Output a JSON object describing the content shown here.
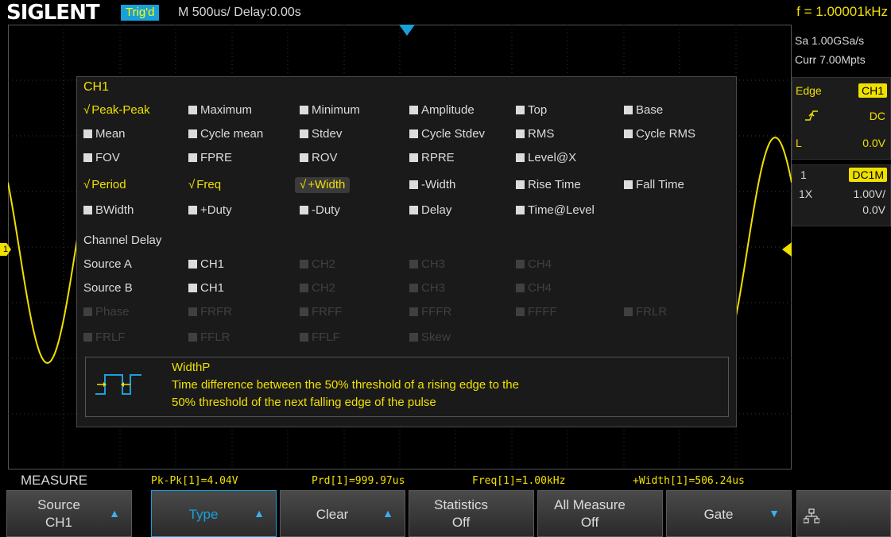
{
  "header": {
    "brand": "SIGLENT",
    "trigger_status": "Trig'd",
    "timebase": "M 500us/   Delay:0.00s",
    "frequency": "f = 1.00001kHz"
  },
  "right_panel": {
    "sample_rate": "Sa 1.00GSa/s",
    "memory": "Curr 7.00Mpts",
    "trigger_type": "Edge",
    "trigger_source": "CH1",
    "coupling": "DC",
    "level_label": "L",
    "level_value": "0.0V",
    "channel_number": "1",
    "channel_coupling": "DC1M",
    "probe": "1X",
    "volts_div": "1.00V/",
    "offset": "0.0V"
  },
  "dialog": {
    "title": "CH1",
    "rows": [
      [
        {
          "label": "Peak-Peak",
          "state": "on"
        },
        {
          "label": "Maximum",
          "state": "off"
        },
        {
          "label": "Minimum",
          "state": "off"
        },
        {
          "label": "Amplitude",
          "state": "off"
        },
        {
          "label": "Top",
          "state": "off"
        },
        {
          "label": "Base",
          "state": "off"
        }
      ],
      [
        {
          "label": "Mean",
          "state": "off"
        },
        {
          "label": "Cycle mean",
          "state": "off"
        },
        {
          "label": "Stdev",
          "state": "off"
        },
        {
          "label": "Cycle Stdev",
          "state": "off"
        },
        {
          "label": "RMS",
          "state": "off"
        },
        {
          "label": "Cycle RMS",
          "state": "off"
        }
      ],
      [
        {
          "label": "FOV",
          "state": "off"
        },
        {
          "label": "FPRE",
          "state": "off"
        },
        {
          "label": "ROV",
          "state": "off"
        },
        {
          "label": "RPRE",
          "state": "off"
        },
        {
          "label": "Level@X",
          "state": "off"
        }
      ],
      [
        {
          "label": "Period",
          "state": "on"
        },
        {
          "label": "Freq",
          "state": "on"
        },
        {
          "label": "+Width",
          "state": "on",
          "selected": true
        },
        {
          "label": "-Width",
          "state": "off"
        },
        {
          "label": "Rise Time",
          "state": "off"
        },
        {
          "label": "Fall Time",
          "state": "off"
        }
      ],
      [
        {
          "label": "BWidth",
          "state": "off"
        },
        {
          "label": "+Duty",
          "state": "off"
        },
        {
          "label": "-Duty",
          "state": "off"
        },
        {
          "label": "Delay",
          "state": "off"
        },
        {
          "label": "Time@Level",
          "state": "off"
        }
      ]
    ],
    "channel_delay_label": "Channel Delay",
    "source_a_label": "Source A",
    "source_b_label": "Source B",
    "source_a": [
      {
        "label": "CH1",
        "state": "off"
      },
      {
        "label": "CH2",
        "state": "dis"
      },
      {
        "label": "CH3",
        "state": "dis"
      },
      {
        "label": "CH4",
        "state": "dis"
      }
    ],
    "source_b": [
      {
        "label": "CH1",
        "state": "off"
      },
      {
        "label": "CH2",
        "state": "dis"
      },
      {
        "label": "CH3",
        "state": "dis"
      },
      {
        "label": "CH4",
        "state": "dis"
      }
    ],
    "delay_rows": [
      [
        {
          "label": "Phase",
          "state": "dis"
        },
        {
          "label": "FRFR",
          "state": "dis"
        },
        {
          "label": "FRFF",
          "state": "dis"
        },
        {
          "label": "FFFR",
          "state": "dis"
        },
        {
          "label": "FFFF",
          "state": "dis"
        },
        {
          "label": "FRLR",
          "state": "dis"
        }
      ],
      [
        {
          "label": "FRLF",
          "state": "dis"
        },
        {
          "label": "FFLR",
          "state": "dis"
        },
        {
          "label": "FFLF",
          "state": "dis"
        },
        {
          "label": "Skew",
          "state": "dis"
        }
      ]
    ],
    "info": {
      "title": "WidthP",
      "line1": "Time difference between the 50% threshold of a rising edge to the",
      "line2": "50% threshold of the next falling edge of the pulse",
      "icon": "width-pulse-icon"
    }
  },
  "measure_bar": {
    "label": "MEASURE",
    "results": [
      "Pk-Pk[1]=4.04V",
      "Prd[1]=999.97us",
      "Freq[1]=1.00kHz",
      "+Width[1]=506.24us"
    ]
  },
  "softkeys": [
    {
      "line1": "Source",
      "line2": "CH1",
      "arrow": "up-arrow-icon",
      "active": false
    },
    {
      "center": "Type",
      "arrow": "up-arrow-icon",
      "active": true
    },
    {
      "center": "Clear",
      "arrow": "up-arrow-icon",
      "active": false
    },
    {
      "line1": "Statistics",
      "line2": "Off",
      "arrow": "",
      "active": false
    },
    {
      "line1": "All Measure",
      "line2": "Off",
      "arrow": "",
      "active": false
    },
    {
      "center": "Gate",
      "arrow": "down-arrow-icon",
      "active": false
    }
  ],
  "waveform": {
    "channel_marker": "1",
    "color": "#f0e000",
    "frequency_khz": 1.00001,
    "peak_to_peak_v": 4.04
  }
}
